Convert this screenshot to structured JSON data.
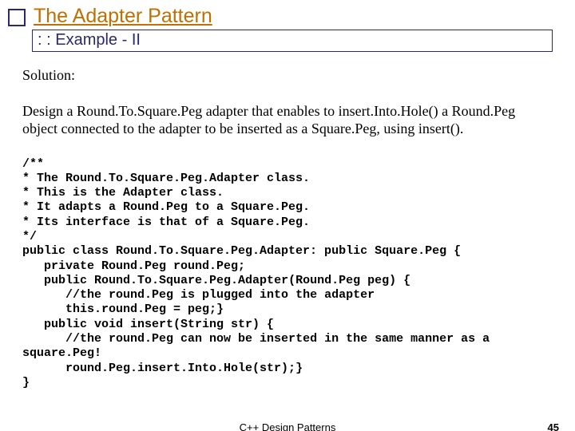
{
  "title": "The Adapter Pattern",
  "subtitle": ": : Example - II",
  "solution_label": "Solution:",
  "design_text": "Design a Round.To.Square.Peg adapter that enables to insert.Into.Hole() a Round.Peg object connected to the adapter to be inserted as a Square.Peg, using insert().",
  "code": "/**\n* The Round.To.Square.Peg.Adapter class.\n* This is the Adapter class.\n* It adapts a Round.Peg to a Square.Peg.\n* Its interface is that of a Square.Peg.\n*/\npublic class Round.To.Square.Peg.Adapter: public Square.Peg {\n   private Round.Peg round.Peg;\n   public Round.To.Square.Peg.Adapter(Round.Peg peg) {\n      //the round.Peg is plugged into the adapter\n      this.round.Peg = peg;}\n   public void insert(String str) {\n      //the round.Peg can now be inserted in the same manner as a square.Peg!\n      round.Peg.insert.Into.Hole(str);}\n}",
  "footer_center": "C++ Design Patterns",
  "page_number": "45"
}
